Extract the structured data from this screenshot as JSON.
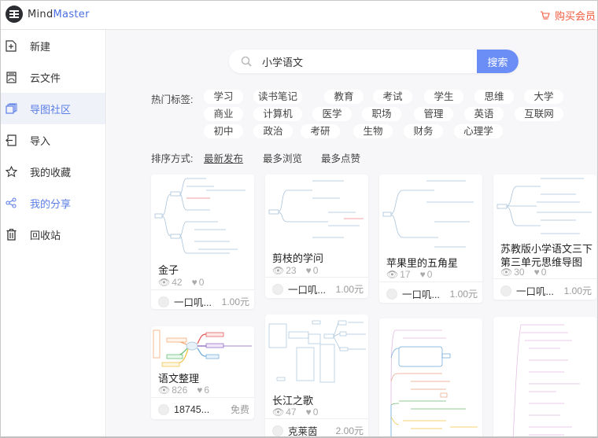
{
  "app": {
    "logo_text_a": "Mind",
    "logo_text_b": "Master",
    "buy_label": "购买会员"
  },
  "sidebar": {
    "items": [
      {
        "label": "新建",
        "icon": "new-file-icon"
      },
      {
        "label": "云文件",
        "icon": "cloud-file-icon"
      },
      {
        "label": "导图社区",
        "icon": "community-icon"
      },
      {
        "label": "导入",
        "icon": "import-icon"
      },
      {
        "label": "我的收藏",
        "icon": "star-icon"
      },
      {
        "label": "我的分享",
        "icon": "share-icon"
      },
      {
        "label": "回收站",
        "icon": "trash-icon"
      }
    ]
  },
  "search": {
    "value": "小学语文",
    "button_label": "搜索"
  },
  "tags": {
    "label": "热门标签:",
    "rows": [
      [
        "学习",
        "读书笔记",
        "教育",
        "考试",
        "学生",
        "思维",
        "大学"
      ],
      [
        "商业",
        "计算机",
        "医学",
        "职场",
        "管理",
        "英语",
        "互联网"
      ],
      [
        "初中",
        "政治",
        "考研",
        "生物",
        "财务",
        "心理学"
      ]
    ]
  },
  "sort": {
    "label": "排序方式:",
    "options": [
      "最新发布",
      "最多浏览",
      "最多点赞"
    ],
    "selected": "最新发布"
  },
  "cards": [
    {
      "title": "金子",
      "views": "42",
      "likes": "0",
      "author": "一口叽...",
      "price": "1.00元"
    },
    {
      "title": "剪枝的学问",
      "views": "23",
      "likes": "0",
      "author": "一口叽...",
      "price": "1.00元"
    },
    {
      "title": "苹果里的五角星",
      "views": "17",
      "likes": "0",
      "author": "一口叽...",
      "price": "1.00元"
    },
    {
      "title": "苏教版小学语文三下第三单元思维导图",
      "title_line1": "苏教版小学语文三下",
      "title_line2": "第三单元思维导图",
      "views": "30",
      "likes": "0",
      "author": "一口叽...",
      "price": "1.00元"
    },
    {
      "title": "语文整理",
      "views": "826",
      "likes": "6",
      "author": "18745...",
      "price": "免费"
    },
    {
      "title": "长江之歌",
      "views": "47",
      "likes": "0",
      "author": "克莱茵",
      "price": "2.00元"
    },
    {
      "title": "",
      "views": "",
      "likes": "",
      "author": "",
      "price": ""
    },
    {
      "title": "",
      "views": "",
      "likes": "",
      "author": "",
      "price": ""
    }
  ],
  "colors": {
    "accent": "#6a8ef5",
    "active_nav": "#5b7ee6",
    "buy": "#f05a3c",
    "background": "#f7f7f9"
  }
}
